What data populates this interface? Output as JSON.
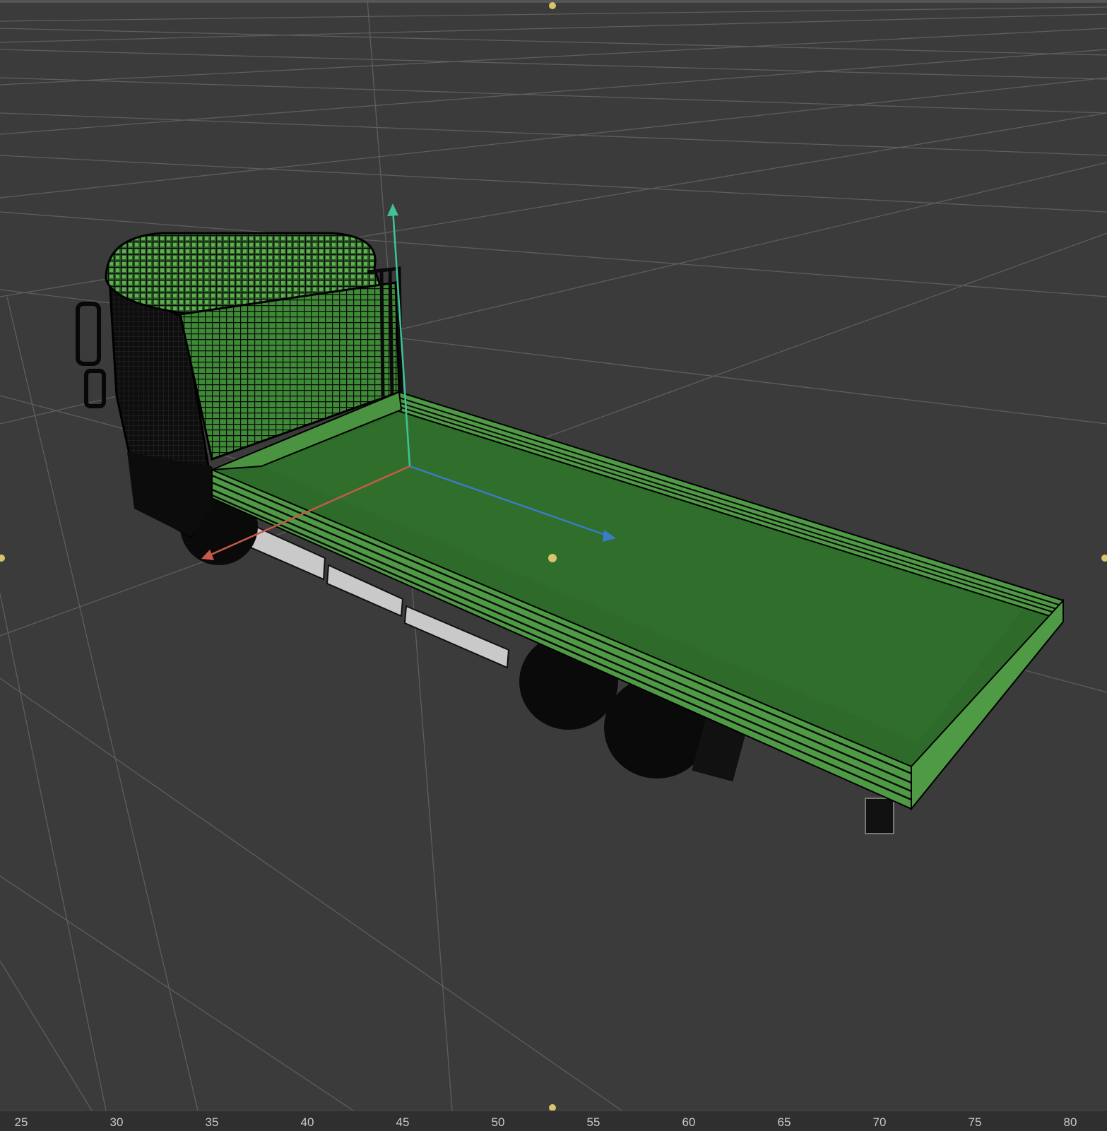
{
  "viewport": {
    "background": "#3b3b3b",
    "grid_color": "#5f5f5f",
    "model_fill": "#2e6b2a",
    "model_rail": "#4f9a44",
    "cab_mesh": "#3f8a37",
    "axis_colors": {
      "x": "#c85a4a",
      "y": "#3fc39a",
      "z": "#3a7cc8"
    },
    "handle_color": "#d8c46a"
  },
  "timeline": {
    "ticks": [
      "25",
      "30",
      "35",
      "40",
      "45",
      "50",
      "55",
      "60",
      "65",
      "70",
      "75",
      "80"
    ]
  }
}
